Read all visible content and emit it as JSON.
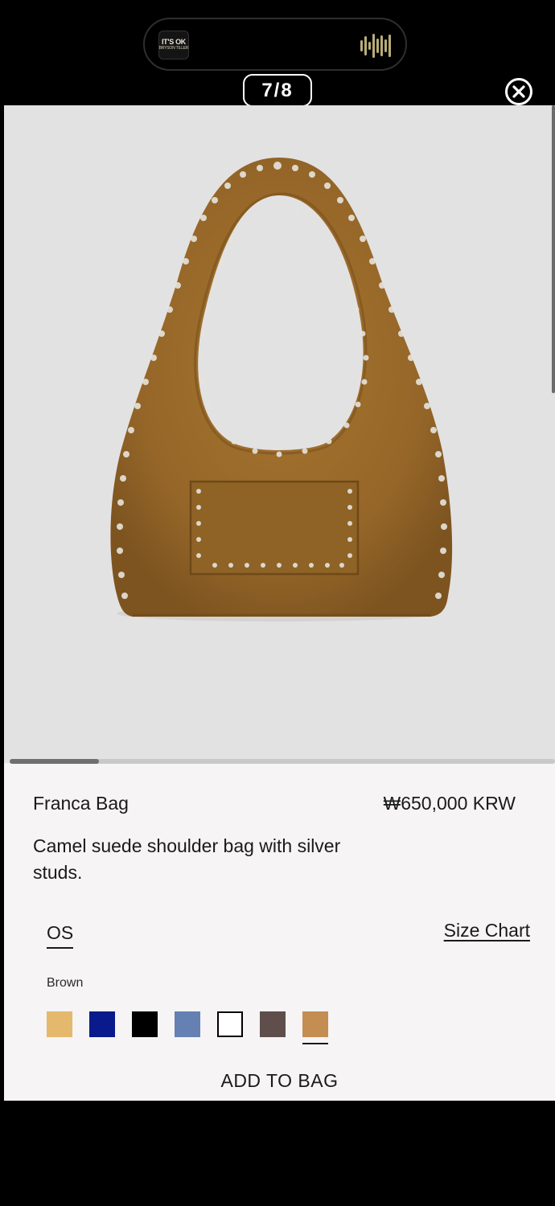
{
  "status_bar": {
    "now_playing": {
      "album_art_line1": "IT'S OK",
      "album_art_line2": "BRYSON TILLER",
      "icon": "waveform-icon"
    }
  },
  "gallery": {
    "counter": "7/8",
    "close_icon": "close-circle-icon"
  },
  "product": {
    "name": "Franca Bag",
    "price": "₩650,000 KRW",
    "description": "Camel suede shoulder bag with silver studs.",
    "size": "OS",
    "size_chart_label": "Size Chart",
    "color_label": "Brown",
    "swatches": [
      {
        "name": "tan",
        "color": "#e4b86d",
        "selected": false
      },
      {
        "name": "navy",
        "color": "#0a1a8c",
        "selected": false
      },
      {
        "name": "black",
        "color": "#000000",
        "selected": false
      },
      {
        "name": "blue-grey",
        "color": "#6580b2",
        "selected": false
      },
      {
        "name": "white",
        "color": "#ffffff",
        "selected": false
      },
      {
        "name": "dark-brown",
        "color": "#5f4e4c",
        "selected": false
      },
      {
        "name": "brown",
        "color": "#c48e52",
        "selected": true
      }
    ],
    "add_to_bag_label": "ADD TO BAG",
    "bag_color": "#9a6b2e"
  }
}
